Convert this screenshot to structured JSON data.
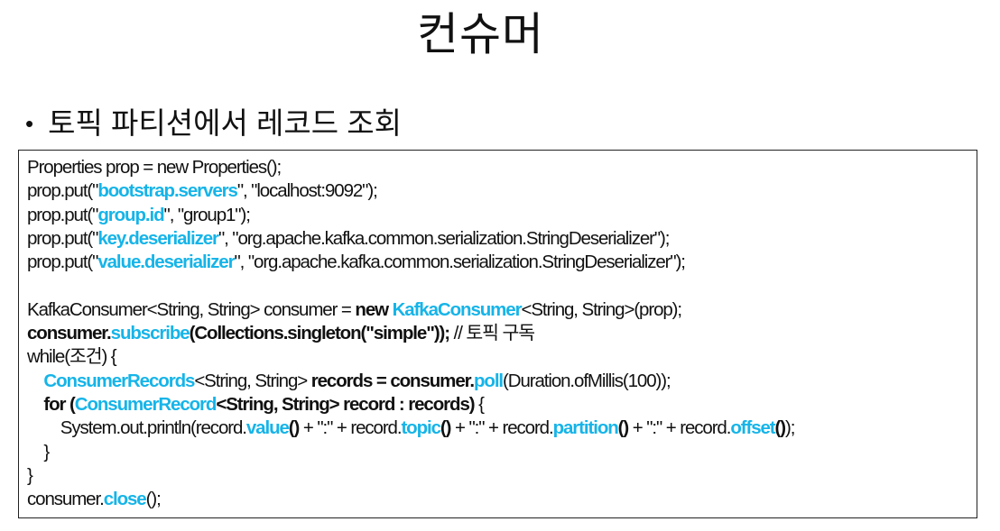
{
  "slide": {
    "title": "컨슈머",
    "bullet_marker": "•",
    "bullet": "토픽 파티션에서 레코드 조회"
  },
  "colors": {
    "keyword_highlight": "#16b4e8",
    "text": "#111111",
    "border": "#222222"
  },
  "code_lines": [
    [
      {
        "t": "Properties prop = new Properties();",
        "s": "p"
      }
    ],
    [
      {
        "t": "prop.put(\"",
        "s": "p"
      },
      {
        "t": "bootstrap.servers",
        "s": "kw"
      },
      {
        "t": "\", \"localhost:9092\");",
        "s": "p"
      }
    ],
    [
      {
        "t": "prop.put(\"",
        "s": "p"
      },
      {
        "t": "group.id",
        "s": "kw"
      },
      {
        "t": "\", \"group1\");",
        "s": "p"
      }
    ],
    [
      {
        "t": "prop.put(\"",
        "s": "p"
      },
      {
        "t": "key.deserializer",
        "s": "kw"
      },
      {
        "t": "\", \"org.apache.kafka.common.serialization.StringDeserializer\");",
        "s": "p"
      }
    ],
    [
      {
        "t": "prop.put(\"",
        "s": "p"
      },
      {
        "t": "value.deserializer",
        "s": "kw"
      },
      {
        "t": "\", \"org.apache.kafka.common.serialization.StringDeserializer\");",
        "s": "p"
      }
    ],
    [],
    [
      {
        "t": "KafkaConsumer<String, String> consumer = ",
        "s": "p"
      },
      {
        "t": "new ",
        "s": "b"
      },
      {
        "t": "KafkaConsumer",
        "s": "kw"
      },
      {
        "t": "<String, String>(prop);",
        "s": "p"
      }
    ],
    [
      {
        "t": "consumer.",
        "s": "b"
      },
      {
        "t": "subscribe",
        "s": "kw"
      },
      {
        "t": "(Collections.singleton(\"simple\"));",
        "s": "b"
      },
      {
        "t": " // 토픽 구독",
        "s": "p"
      }
    ],
    [
      {
        "t": "while(조건) {",
        "s": "p"
      }
    ],
    [
      {
        "t": "    ",
        "s": "p"
      },
      {
        "t": "ConsumerRecords",
        "s": "kw"
      },
      {
        "t": "<String, String> ",
        "s": "p"
      },
      {
        "t": "records = consumer.",
        "s": "b"
      },
      {
        "t": "poll",
        "s": "kw"
      },
      {
        "t": "(Duration.ofMillis(100));",
        "s": "p"
      }
    ],
    [
      {
        "t": "    ",
        "s": "p"
      },
      {
        "t": "for (",
        "s": "b"
      },
      {
        "t": "ConsumerRecord",
        "s": "kw"
      },
      {
        "t": "<String, String> record : records)",
        "s": "b"
      },
      {
        "t": " {",
        "s": "p"
      }
    ],
    [
      {
        "t": "        System.out.println(record.",
        "s": "p"
      },
      {
        "t": "value",
        "s": "kw"
      },
      {
        "t": "()",
        "s": "b"
      },
      {
        "t": " + \":\" + record.",
        "s": "p"
      },
      {
        "t": "topic",
        "s": "kw"
      },
      {
        "t": "()",
        "s": "b"
      },
      {
        "t": " + \":\" + record.",
        "s": "p"
      },
      {
        "t": "partition",
        "s": "kw"
      },
      {
        "t": "()",
        "s": "b"
      },
      {
        "t": " + \":\" + record.",
        "s": "p"
      },
      {
        "t": "offset",
        "s": "kw"
      },
      {
        "t": "()",
        "s": "b"
      },
      {
        "t": ");",
        "s": "p"
      }
    ],
    [
      {
        "t": "    }",
        "s": "p"
      }
    ],
    [
      {
        "t": "}",
        "s": "p"
      }
    ],
    [
      {
        "t": "consumer.",
        "s": "p"
      },
      {
        "t": "close",
        "s": "kw"
      },
      {
        "t": "();",
        "s": "p"
      }
    ]
  ]
}
